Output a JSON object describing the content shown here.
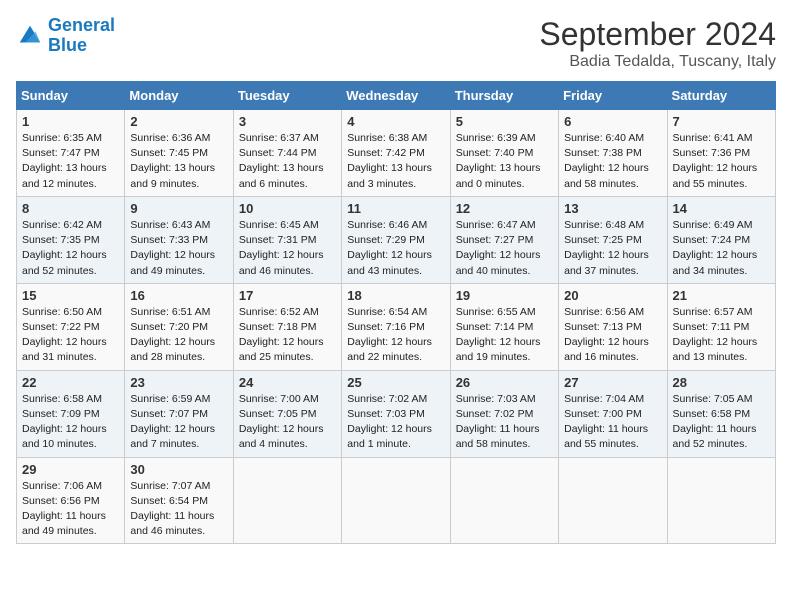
{
  "logo": {
    "line1": "General",
    "line2": "Blue"
  },
  "title": "September 2024",
  "subtitle": "Badia Tedalda, Tuscany, Italy",
  "headers": [
    "Sunday",
    "Monday",
    "Tuesday",
    "Wednesday",
    "Thursday",
    "Friday",
    "Saturday"
  ],
  "weeks": [
    [
      {
        "day": "1",
        "info": "Sunrise: 6:35 AM\nSunset: 7:47 PM\nDaylight: 13 hours\nand 12 minutes."
      },
      {
        "day": "2",
        "info": "Sunrise: 6:36 AM\nSunset: 7:45 PM\nDaylight: 13 hours\nand 9 minutes."
      },
      {
        "day": "3",
        "info": "Sunrise: 6:37 AM\nSunset: 7:44 PM\nDaylight: 13 hours\nand 6 minutes."
      },
      {
        "day": "4",
        "info": "Sunrise: 6:38 AM\nSunset: 7:42 PM\nDaylight: 13 hours\nand 3 minutes."
      },
      {
        "day": "5",
        "info": "Sunrise: 6:39 AM\nSunset: 7:40 PM\nDaylight: 13 hours\nand 0 minutes."
      },
      {
        "day": "6",
        "info": "Sunrise: 6:40 AM\nSunset: 7:38 PM\nDaylight: 12 hours\nand 58 minutes."
      },
      {
        "day": "7",
        "info": "Sunrise: 6:41 AM\nSunset: 7:36 PM\nDaylight: 12 hours\nand 55 minutes."
      }
    ],
    [
      {
        "day": "8",
        "info": "Sunrise: 6:42 AM\nSunset: 7:35 PM\nDaylight: 12 hours\nand 52 minutes."
      },
      {
        "day": "9",
        "info": "Sunrise: 6:43 AM\nSunset: 7:33 PM\nDaylight: 12 hours\nand 49 minutes."
      },
      {
        "day": "10",
        "info": "Sunrise: 6:45 AM\nSunset: 7:31 PM\nDaylight: 12 hours\nand 46 minutes."
      },
      {
        "day": "11",
        "info": "Sunrise: 6:46 AM\nSunset: 7:29 PM\nDaylight: 12 hours\nand 43 minutes."
      },
      {
        "day": "12",
        "info": "Sunrise: 6:47 AM\nSunset: 7:27 PM\nDaylight: 12 hours\nand 40 minutes."
      },
      {
        "day": "13",
        "info": "Sunrise: 6:48 AM\nSunset: 7:25 PM\nDaylight: 12 hours\nand 37 minutes."
      },
      {
        "day": "14",
        "info": "Sunrise: 6:49 AM\nSunset: 7:24 PM\nDaylight: 12 hours\nand 34 minutes."
      }
    ],
    [
      {
        "day": "15",
        "info": "Sunrise: 6:50 AM\nSunset: 7:22 PM\nDaylight: 12 hours\nand 31 minutes."
      },
      {
        "day": "16",
        "info": "Sunrise: 6:51 AM\nSunset: 7:20 PM\nDaylight: 12 hours\nand 28 minutes."
      },
      {
        "day": "17",
        "info": "Sunrise: 6:52 AM\nSunset: 7:18 PM\nDaylight: 12 hours\nand 25 minutes."
      },
      {
        "day": "18",
        "info": "Sunrise: 6:54 AM\nSunset: 7:16 PM\nDaylight: 12 hours\nand 22 minutes."
      },
      {
        "day": "19",
        "info": "Sunrise: 6:55 AM\nSunset: 7:14 PM\nDaylight: 12 hours\nand 19 minutes."
      },
      {
        "day": "20",
        "info": "Sunrise: 6:56 AM\nSunset: 7:13 PM\nDaylight: 12 hours\nand 16 minutes."
      },
      {
        "day": "21",
        "info": "Sunrise: 6:57 AM\nSunset: 7:11 PM\nDaylight: 12 hours\nand 13 minutes."
      }
    ],
    [
      {
        "day": "22",
        "info": "Sunrise: 6:58 AM\nSunset: 7:09 PM\nDaylight: 12 hours\nand 10 minutes."
      },
      {
        "day": "23",
        "info": "Sunrise: 6:59 AM\nSunset: 7:07 PM\nDaylight: 12 hours\nand 7 minutes."
      },
      {
        "day": "24",
        "info": "Sunrise: 7:00 AM\nSunset: 7:05 PM\nDaylight: 12 hours\nand 4 minutes."
      },
      {
        "day": "25",
        "info": "Sunrise: 7:02 AM\nSunset: 7:03 PM\nDaylight: 12 hours\nand 1 minute."
      },
      {
        "day": "26",
        "info": "Sunrise: 7:03 AM\nSunset: 7:02 PM\nDaylight: 11 hours\nand 58 minutes."
      },
      {
        "day": "27",
        "info": "Sunrise: 7:04 AM\nSunset: 7:00 PM\nDaylight: 11 hours\nand 55 minutes."
      },
      {
        "day": "28",
        "info": "Sunrise: 7:05 AM\nSunset: 6:58 PM\nDaylight: 11 hours\nand 52 minutes."
      }
    ],
    [
      {
        "day": "29",
        "info": "Sunrise: 7:06 AM\nSunset: 6:56 PM\nDaylight: 11 hours\nand 49 minutes."
      },
      {
        "day": "30",
        "info": "Sunrise: 7:07 AM\nSunset: 6:54 PM\nDaylight: 11 hours\nand 46 minutes."
      },
      {
        "day": "",
        "info": ""
      },
      {
        "day": "",
        "info": ""
      },
      {
        "day": "",
        "info": ""
      },
      {
        "day": "",
        "info": ""
      },
      {
        "day": "",
        "info": ""
      }
    ]
  ]
}
